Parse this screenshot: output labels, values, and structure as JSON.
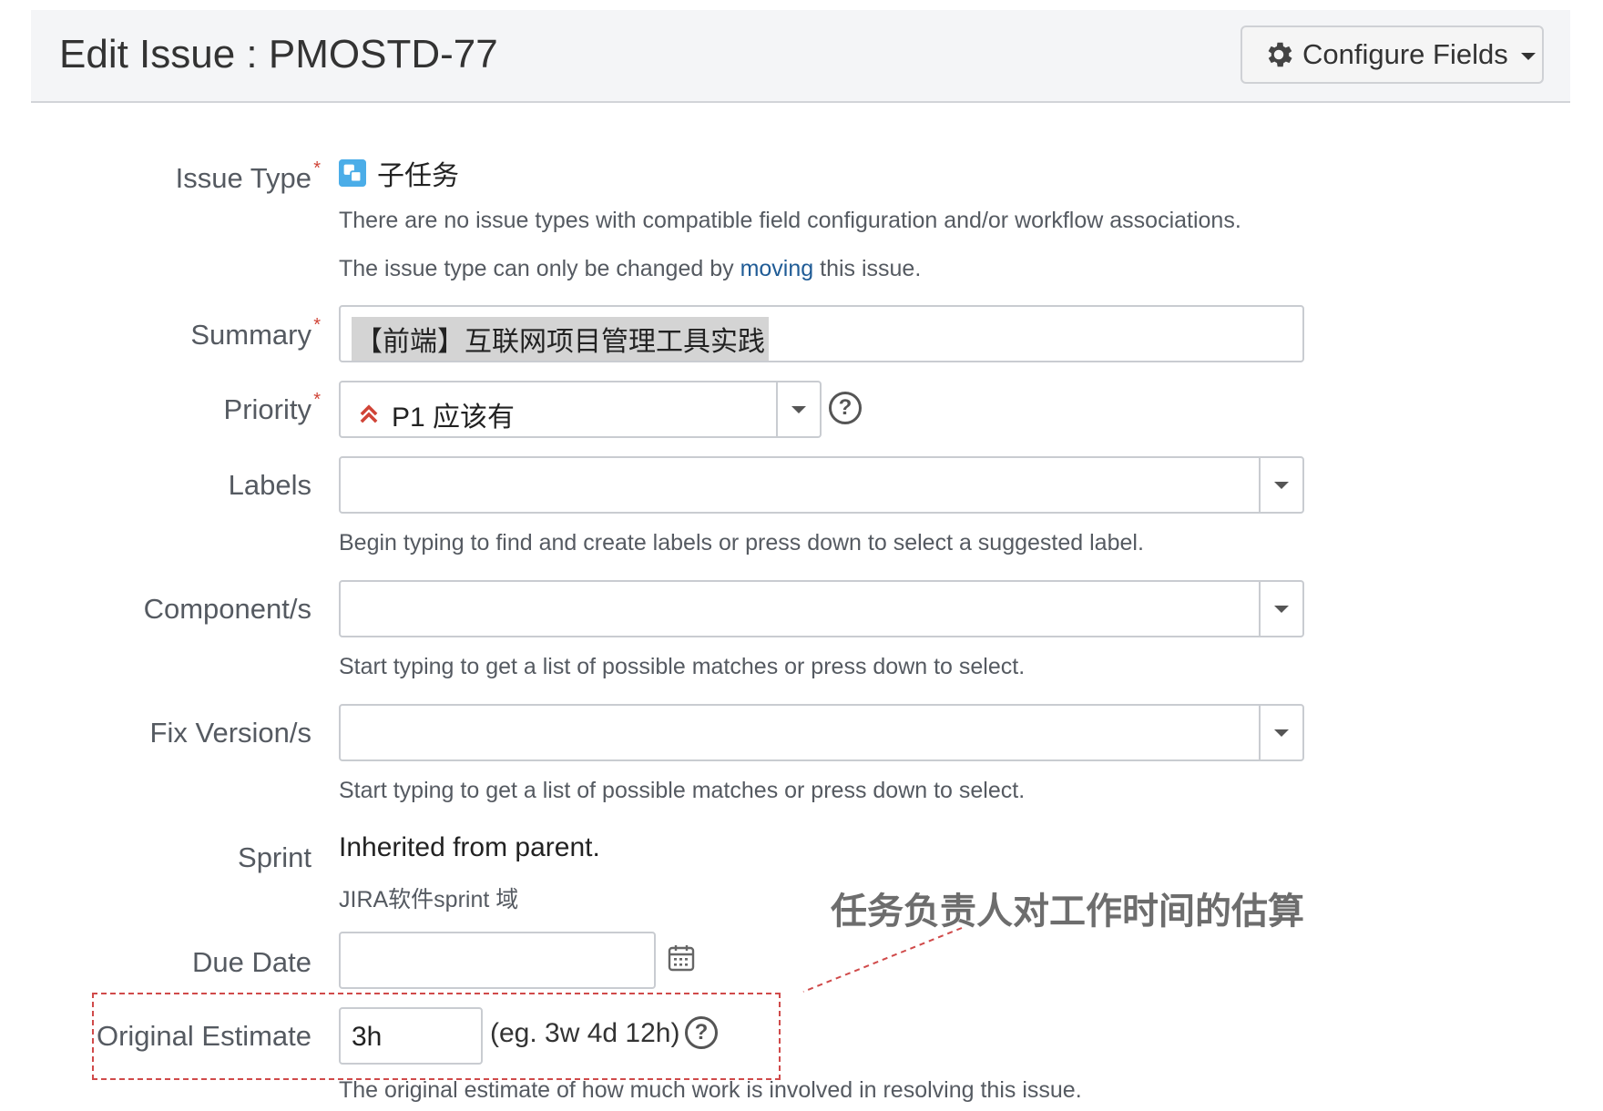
{
  "header": {
    "title": "Edit Issue : PMOSTD-77",
    "configure_label": "Configure Fields"
  },
  "issue_type": {
    "label": "Issue Type",
    "value": "子任务",
    "note1": "There are no issue types with compatible field configuration and/or workflow associations.",
    "note2_pre": "The issue type can only be changed by ",
    "note2_link": "moving",
    "note2_post": " this issue."
  },
  "summary": {
    "label": "Summary",
    "value": "【前端】互联网项目管理工具实践"
  },
  "priority": {
    "label": "Priority",
    "value": "P1 应该有",
    "icon_color": "#d04437"
  },
  "labels": {
    "label": "Labels",
    "hint": "Begin typing to find and create labels or press down to select a suggested label."
  },
  "components": {
    "label": "Component/s",
    "hint": "Start typing to get a list of possible matches or press down to select."
  },
  "fix_versions": {
    "label": "Fix Version/s",
    "hint": "Start typing to get a list of possible matches or press down to select."
  },
  "sprint": {
    "label": "Sprint",
    "value": "Inherited from parent.",
    "sub": "JIRA软件sprint 域"
  },
  "due_date": {
    "label": "Due Date",
    "value": ""
  },
  "original_estimate": {
    "label": "Original Estimate",
    "value": "3h",
    "example": "(eg. 3w 4d 12h)",
    "hint": "The original estimate of how much work is involved in resolving this issue."
  },
  "annotation": {
    "text": "任务负责人对工作时间的估算",
    "color": "#d04a4a"
  }
}
